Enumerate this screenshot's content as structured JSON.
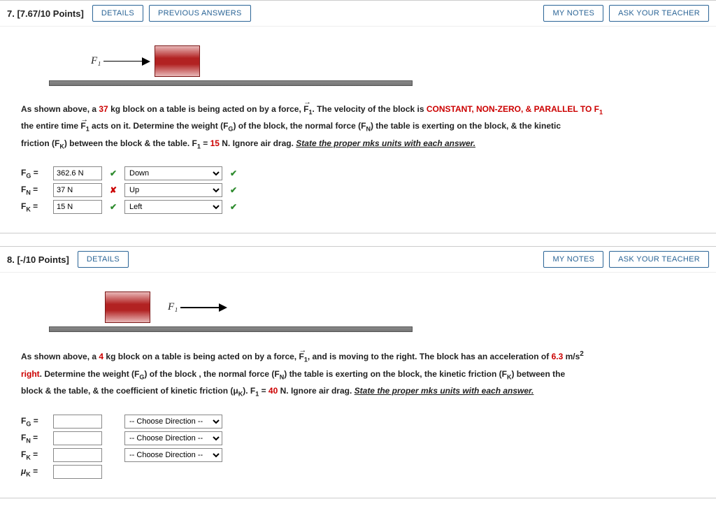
{
  "buttons": {
    "details": "DETAILS",
    "previous": "PREVIOUS ANSWERS",
    "notes": "MY NOTES",
    "ask": "ASK YOUR TEACHER"
  },
  "q7": {
    "header": "7.  [7.67/10 Points]",
    "force_label": "F₁",
    "text": {
      "p1a": "As shown above, a ",
      "mass": "37",
      "p1b": " kg block on a table is being acted on by a force, ",
      "p1c": ". The velocity of the block is ",
      "const": "CONSTANT, NON-ZERO, & PARALLEL TO F",
      "const_sub": "1",
      "p2a": "the entire time ",
      "p2b": " acts on it. Determine the weight (F",
      "gsub": "G",
      "p2c": ") of the block, the normal force (F",
      "nsub": "N",
      "p2d": ") the table is exerting on the block, & the kinetic",
      "p3a": "friction (F",
      "ksub": "K",
      "p3b": ") between the block & the table. F",
      "p3c": " = ",
      "fval": "15",
      "p3d": " N. Ignore air drag. ",
      "state": "State the proper mks units with each answer."
    },
    "rows": [
      {
        "label": "F_G =",
        "value": "362.6 N",
        "mark": "ok",
        "dir": "Down",
        "dmark": "ok"
      },
      {
        "label": "F_N =",
        "value": "37 N",
        "mark": "x",
        "dir": "Up",
        "dmark": "ok"
      },
      {
        "label": "F_K =",
        "value": "15 N",
        "mark": "ok",
        "dir": "Left",
        "dmark": "ok"
      }
    ]
  },
  "q8": {
    "header": "8.  [-/10 Points]",
    "force_label": "F₁",
    "text": {
      "p1a": "As shown above, a ",
      "mass": "4",
      "p1b": " kg block on a table is being acted on by a force, ",
      "p1c": ", and is moving to the right. The block has an acceleration of ",
      "acc": "6.3",
      "p1d": " m/s",
      "p2a": "right",
      "p2b": ". Determine the weight (F",
      "gsub": "G",
      "p2c": ") of the block , the normal force (F",
      "nsub": "N",
      "p2d": ") the table is exerting on the block, the kinetic friction (F",
      "ksub": "K",
      "p2e": ") between the",
      "p3a": "block & the table, & the coefficient of kinetic friction (μ",
      "p3b": "). F",
      "p3c": " = ",
      "fval": "40",
      "p3d": " N. Ignore air drag. ",
      "state": "State the proper mks units with each answer."
    },
    "rows": [
      {
        "label": "F_G =",
        "value": "",
        "dir": "-- Choose Direction --"
      },
      {
        "label": "F_N =",
        "value": "",
        "dir": "-- Choose Direction --"
      },
      {
        "label": "F_K =",
        "value": "",
        "dir": "-- Choose Direction --"
      },
      {
        "label": "μ_K =",
        "value": "",
        "dir": null
      }
    ]
  }
}
